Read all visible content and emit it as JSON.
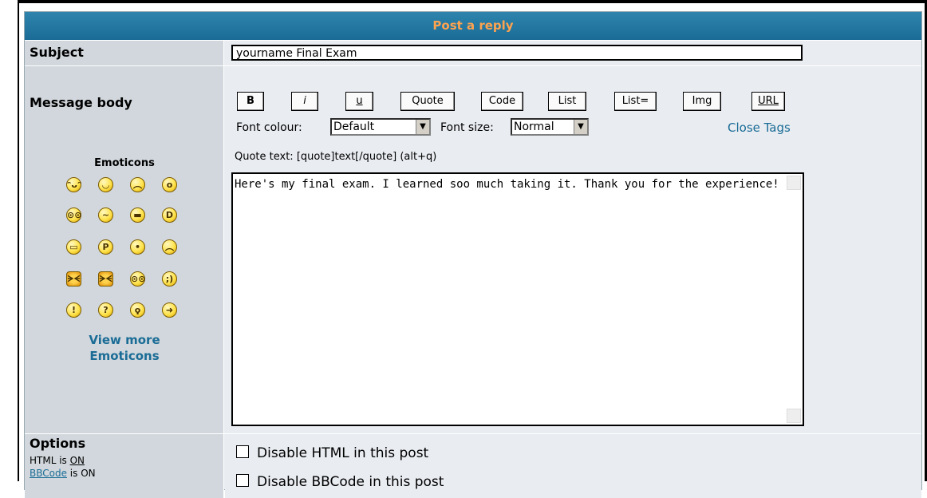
{
  "header": {
    "title": "Post a reply"
  },
  "subject": {
    "label": "Subject",
    "value": "yourname Final Exam"
  },
  "body": {
    "label": "Message body",
    "buttons": [
      "B",
      "i",
      "u",
      "Quote",
      "Code",
      "List",
      "List=",
      "Img",
      "URL"
    ],
    "font_colour_label": "Font colour:",
    "font_colour_value": "Default",
    "font_size_label": "Font size:",
    "font_size_value": "Normal",
    "close_tags": "Close Tags",
    "hint": "Quote text: [quote]text[/quote]  (alt+q)",
    "message": "Here's my final exam. I learned soo much taking it. Thank you for the experience!"
  },
  "emoticons": {
    "title": "Emoticons",
    "items": [
      "very-happy",
      "smile",
      "sad",
      "surprised",
      "shocked",
      "confused",
      "cool",
      "laughing",
      "mad",
      "razz",
      "embarrassed",
      "crying",
      "evil",
      "twisted-evil",
      "rolling-eyes",
      "wink",
      "exclamation",
      "question",
      "idea",
      "arrow"
    ],
    "view_more_line1": "View more",
    "view_more_line2": "Emoticons"
  },
  "options": {
    "title": "Options",
    "html_status_label": "HTML is ",
    "html_status_value": "ON",
    "bbcode_label": "BBCode",
    "bbcode_status": " is ON",
    "items": [
      "Disable HTML in this post",
      "Disable BBCode in this post"
    ]
  },
  "colors": {
    "header_bg": "#1a6c96",
    "header_text": "#ffa34f",
    "link": "#1a6c96",
    "panel": "#e9ecf1",
    "label_col": "#d1d7dc"
  }
}
